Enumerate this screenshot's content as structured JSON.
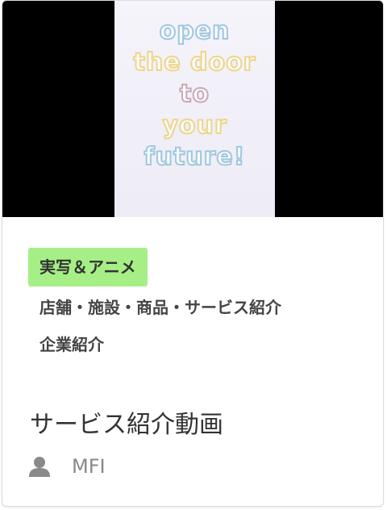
{
  "thumbnail": {
    "lines": [
      "open",
      "the door",
      "to",
      "your",
      "future!"
    ]
  },
  "tags": {
    "main": "実写＆アニメ",
    "line2": "店舗・施設・商品・サービス紹介",
    "line3": "企業紹介"
  },
  "title": "サービス紹介動画",
  "author": {
    "icon": "user-icon",
    "name": "MFI"
  },
  "colors": {
    "tag_bg": "#a6ef86",
    "thumb_bg": "#000000"
  }
}
